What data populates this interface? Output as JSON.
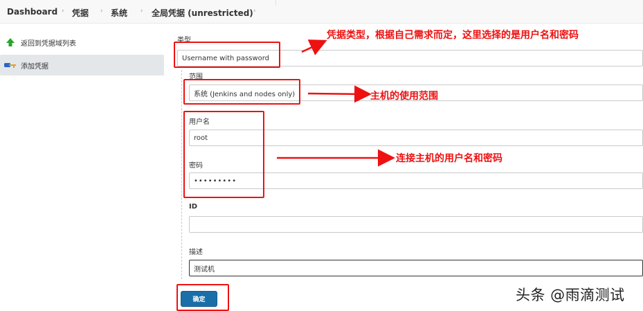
{
  "breadcrumb": {
    "items": [
      "Dashboard",
      "凭据",
      "系统",
      "全局凭据 (unrestricted)"
    ],
    "separator": "›"
  },
  "sidebar": {
    "items": [
      {
        "label": "返回到凭据域列表",
        "icon": "green-up-arrow-icon"
      },
      {
        "label": "添加凭据",
        "icon": "key-icon",
        "active": true
      }
    ]
  },
  "form": {
    "kind_label": "类型",
    "kind_value": "Username with password",
    "scope_label": "范围",
    "scope_value": "系统 (Jenkins and nodes only)",
    "username_label": "用户名",
    "username_value": "root",
    "password_label": "密码",
    "password_value": "•••••••••",
    "id_label": "ID",
    "id_value": "",
    "description_label": "描述",
    "description_value": "测试机",
    "submit_label": "确定"
  },
  "annotations": {
    "kind_note": "凭据类型，根据自己需求而定，这里选择的是用户名和密码",
    "scope_note": "主机的使用范围",
    "credentials_note": "连接主机的用户名和密码"
  },
  "watermark": "头条 @雨滴测试",
  "colors": {
    "annotation": "#ee1111",
    "button": "#1b6fa8",
    "active_sidebar": "#e4e7ea"
  }
}
